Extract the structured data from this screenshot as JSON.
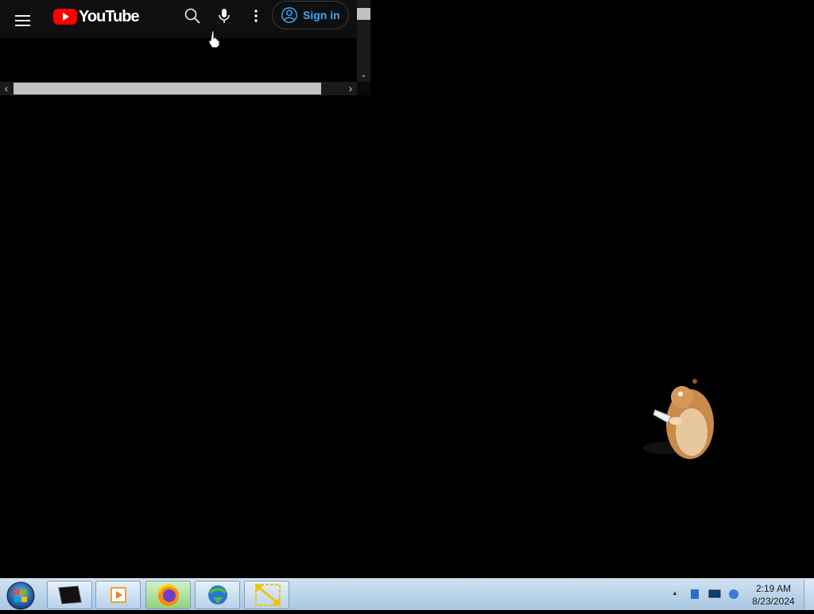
{
  "browser": {
    "header": {
      "logo_text": "YouTube",
      "signin_label": "Sign in"
    },
    "icons": {
      "menu": "hamburger-icon",
      "search": "search-icon",
      "mic": "microphone-icon",
      "more": "more-vert-icon",
      "account": "account-icon"
    },
    "scrollbars": {
      "left_arrow": "‹",
      "right_arrow": "›",
      "down_arrow": "⌄"
    },
    "colors": {
      "brand_red": "#ff0000",
      "signin_blue": "#3ea6ff",
      "header_bg": "#0f0f0f"
    }
  },
  "taskbar": {
    "apps": [
      {
        "name": "terminal-app-icon"
      },
      {
        "name": "media-player-icon"
      },
      {
        "name": "firefox-icon"
      },
      {
        "name": "download-manager-icon"
      },
      {
        "name": "resize-tool-icon"
      }
    ],
    "tray": {
      "show_hidden": "▲",
      "clock_time": "2:19 AM",
      "clock_date": "8/23/2024"
    }
  }
}
